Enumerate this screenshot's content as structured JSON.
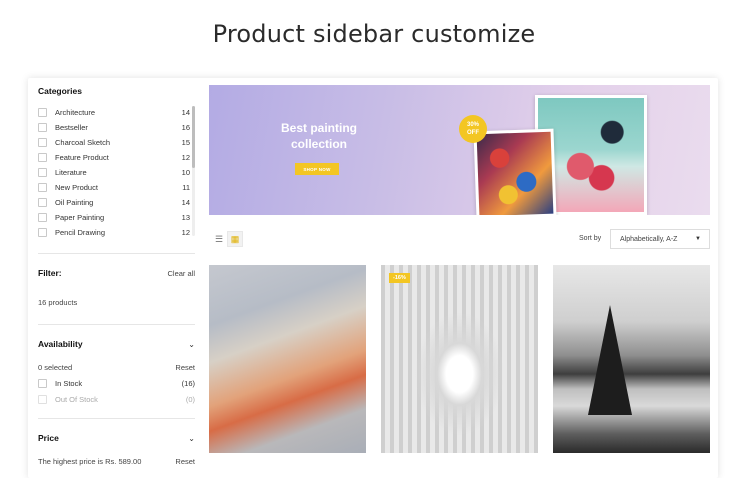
{
  "page": {
    "heading": "Product sidebar customize"
  },
  "sidebar": {
    "categories_title": "Categories",
    "categories": [
      {
        "label": "Architecture",
        "count": "14"
      },
      {
        "label": "Bestseller",
        "count": "16"
      },
      {
        "label": "Charcoal Sketch",
        "count": "15"
      },
      {
        "label": "Feature Product",
        "count": "12"
      },
      {
        "label": "Literature",
        "count": "10"
      },
      {
        "label": "New Product",
        "count": "11"
      },
      {
        "label": "Oil Painting",
        "count": "14"
      },
      {
        "label": "Paper Painting",
        "count": "13"
      },
      {
        "label": "Pencil Drawing",
        "count": "12"
      }
    ],
    "filter": {
      "title": "Filter:",
      "clear_label": "Clear all",
      "product_count": "16 products"
    },
    "availability": {
      "title": "Availability",
      "selected": "0 selected",
      "reset": "Reset",
      "options": [
        {
          "label": "In Stock",
          "count": "(16)"
        },
        {
          "label": "Out Of Stock",
          "count": "(0)"
        }
      ]
    },
    "price": {
      "title": "Price",
      "highest": "The highest price is Rs. 589.00",
      "reset": "Reset"
    }
  },
  "banner": {
    "title": "Best painting collection",
    "button_label": "SHOP NOW",
    "badge_value": "30%",
    "badge_sub": "OFF"
  },
  "toolbar": {
    "sort_label": "Sort by",
    "sort_value": "Alphabetically, A-Z"
  },
  "products": [
    {
      "tag": ""
    },
    {
      "tag": "-16%"
    },
    {
      "tag": ""
    }
  ],
  "colors": {
    "accent": "#f3c623",
    "banner_start": "#b3abe4",
    "banner_end": "#eadcee"
  },
  "icons": {
    "list_view": "list-icon",
    "grid_view": "grid-icon",
    "chevron": "chevron-down-icon",
    "caret": "caret-down-icon"
  }
}
